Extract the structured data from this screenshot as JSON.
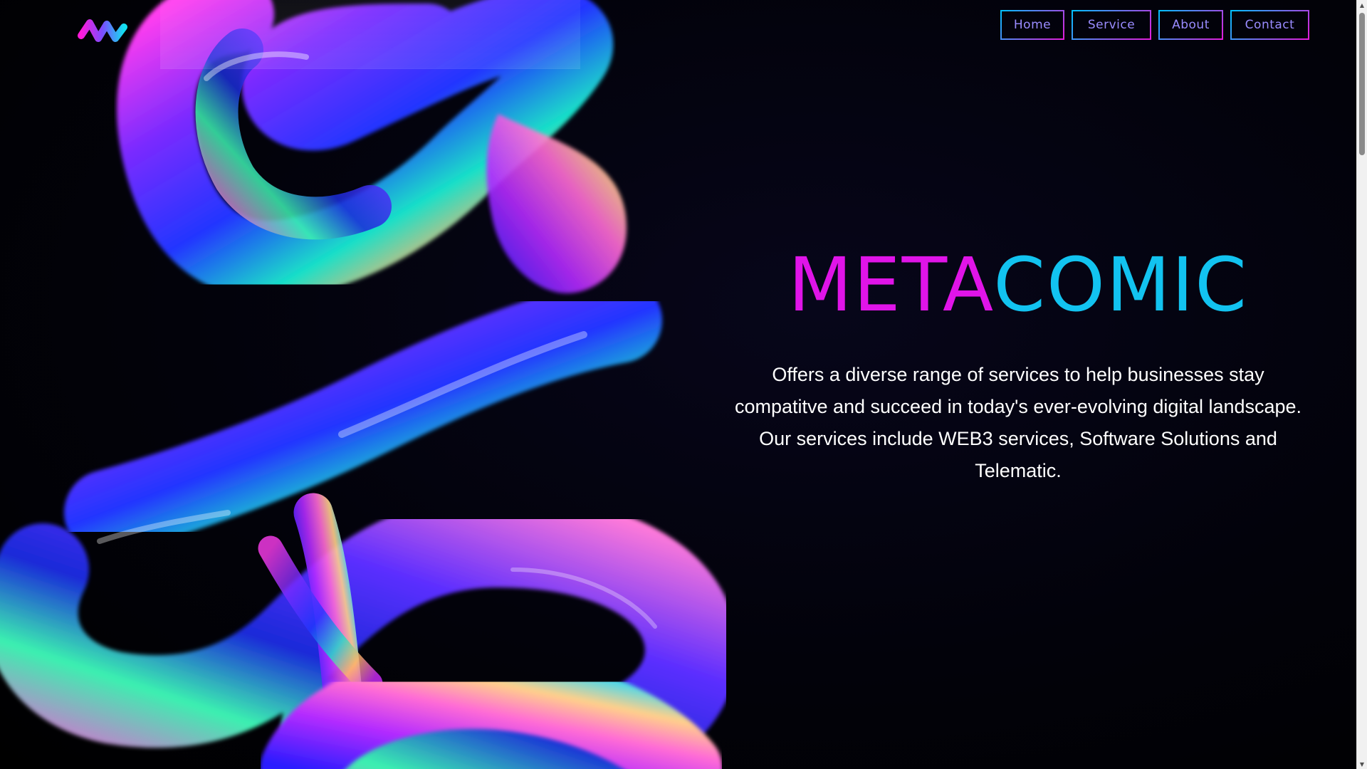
{
  "brand": {
    "part1": "META",
    "part2": "COMIC"
  },
  "nav": {
    "home": "Home",
    "service": "Service",
    "about": "About",
    "contact": "Contact"
  },
  "hero": {
    "tagline": "Offers a diverse range of services to help businesses stay compatitve and succeed in today's ever-evolving digital landscape. Our services include WEB3 services, Software Solutions and Telematic."
  },
  "colors": {
    "meta": "#e014e8",
    "comic": "#12c3f0",
    "background": "#000000",
    "nav_text": "#9a8cff"
  },
  "icons": {
    "logo": "m-wave-logo",
    "scroll_up": "triangle-up-icon",
    "scroll_down": "triangle-down-icon"
  }
}
